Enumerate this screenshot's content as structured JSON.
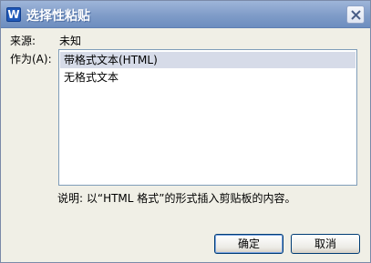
{
  "window": {
    "title": "选择性粘贴",
    "app_icon_letter": "W"
  },
  "source": {
    "label": "来源:",
    "value": "未知"
  },
  "as": {
    "label": "作为(A):",
    "options": [
      {
        "label": "带格式文本(HTML)",
        "selected": true
      },
      {
        "label": "无格式文本",
        "selected": false
      }
    ]
  },
  "description": "说明: 以“HTML 格式”的形式插入剪贴板的内容。",
  "buttons": {
    "ok": "确定",
    "cancel": "取消"
  },
  "colors": {
    "titlebar": "#7f9cc8",
    "selection": "#d6dbe8",
    "dialog_bg": "#f0efe6"
  }
}
